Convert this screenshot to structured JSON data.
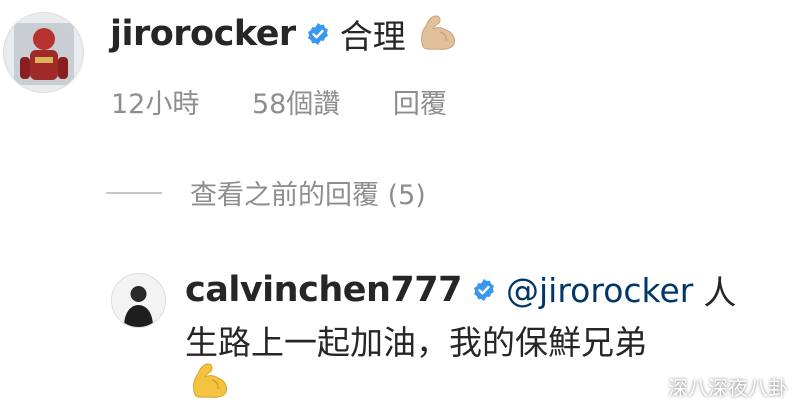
{
  "comment1": {
    "username": "jirorocker",
    "text": "合理",
    "emoji": "flexed-biceps",
    "meta": {
      "time": "12小時",
      "likes": "58個讚",
      "reply": "回覆"
    }
  },
  "view_previous": {
    "label": "查看之前的回覆 (5)"
  },
  "comment2": {
    "username": "calvinchen777",
    "mention": "@jirorocker",
    "text_line1_end": "人",
    "text_line2": "生路上一起加油，我的保鮮兄弟",
    "emoji": "flexed-biceps"
  },
  "watermark": {
    "text": "深八深夜八卦"
  },
  "colors": {
    "verified": "#3897f0",
    "meta_gray": "#8e8e8e",
    "mention": "#00376b"
  }
}
